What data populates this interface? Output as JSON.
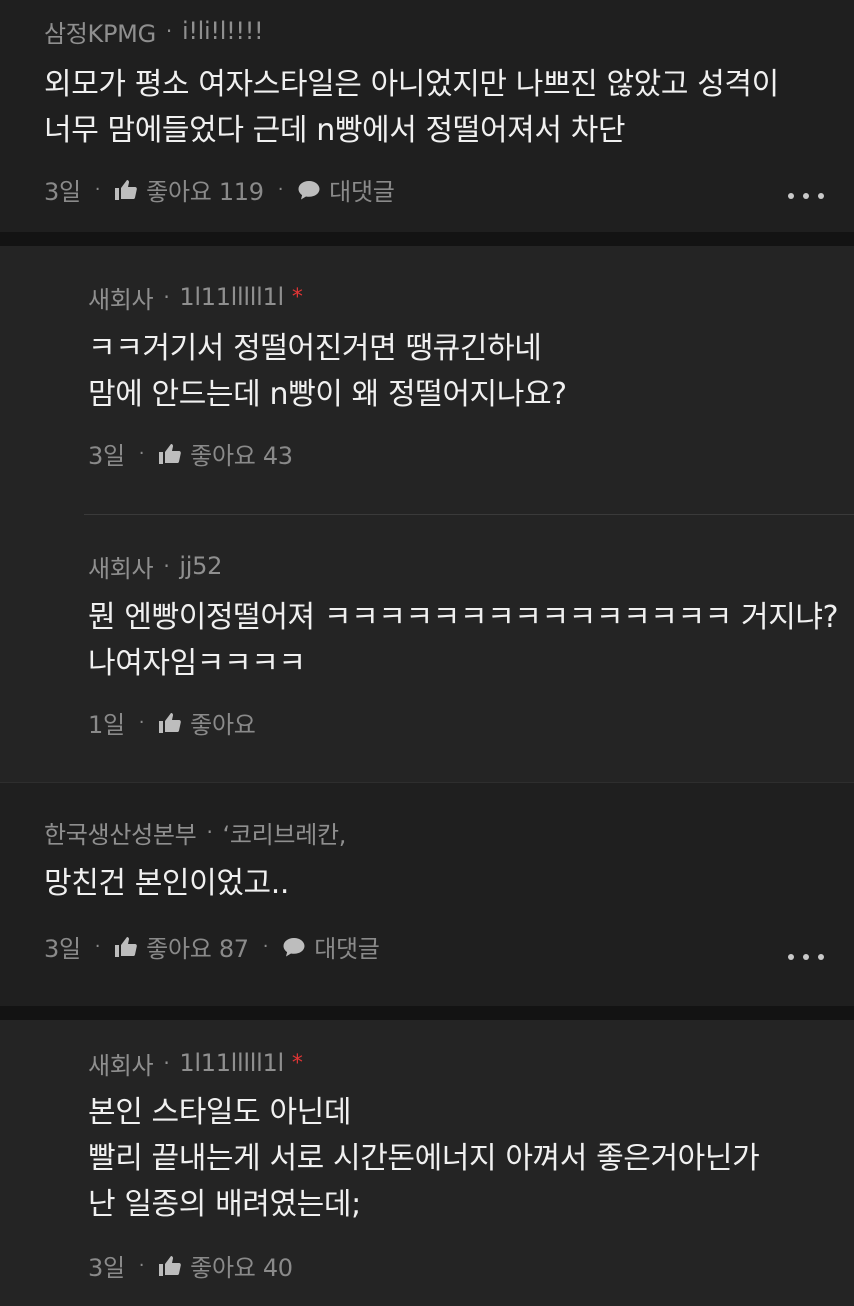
{
  "comments": [
    {
      "company": "삼정KPMG",
      "nickname": "i!li!l!!!!",
      "lines": [
        "외모가 평소 여자스타일은 아니었지만 나쁘진 않았고 성격이",
        "너무 맘에들었다 근데 n빵에서 정떨어져서 차단"
      ],
      "time": "3일",
      "like_label": "좋아요 119",
      "reply_label": "대댓글",
      "replies": [
        {
          "company": "새회사",
          "nickname": "1l11lllll1l",
          "author_mark": "*",
          "lines": [
            "ㅋㅋ거기서 정떨어진거면 땡큐긴하네",
            "맘에 안드는데 n빵이 왜 정떨어지나요?"
          ],
          "time": "3일",
          "like_label": "좋아요 43"
        },
        {
          "company": "새회사",
          "nickname": "jj52",
          "lines": [
            "뭔 엔빵이정떨어져 ㅋㅋㅋㅋㅋㅋㅋㅋㅋㅋㅋㅋㅋㅋㅋ 거지냐?",
            "나여자임ㅋㅋㅋㅋ"
          ],
          "time": "1일",
          "like_label": "좋아요"
        }
      ]
    },
    {
      "company": "한국생산성본부",
      "nickname": "‘코리브레칸,",
      "lines": [
        "망친건 본인이었고.."
      ],
      "time": "3일",
      "like_label": "좋아요 87",
      "reply_label": "대댓글",
      "replies": [
        {
          "company": "새회사",
          "nickname": "1l11lllll1l",
          "author_mark": "*",
          "lines": [
            "본인 스타일도 아닌데",
            "빨리 끝내는게 서로 시간돈에너지 아껴서 좋은거아닌가",
            "난 일종의 배려였는데;"
          ],
          "time": "3일",
          "like_label": "좋아요 40"
        }
      ]
    }
  ],
  "separator_dot": "·",
  "icons": {
    "like": "thumbs-up-icon",
    "reply": "speech-bubble-icon",
    "more": "more-dots-icon"
  },
  "colors": {
    "background": "#131313",
    "comment_bg": "#1f1f1f",
    "reply_bg": "#242424",
    "author_mark": "#e03535",
    "meta_text": "#8f8f8f",
    "body_text": "#f0f0f0"
  }
}
